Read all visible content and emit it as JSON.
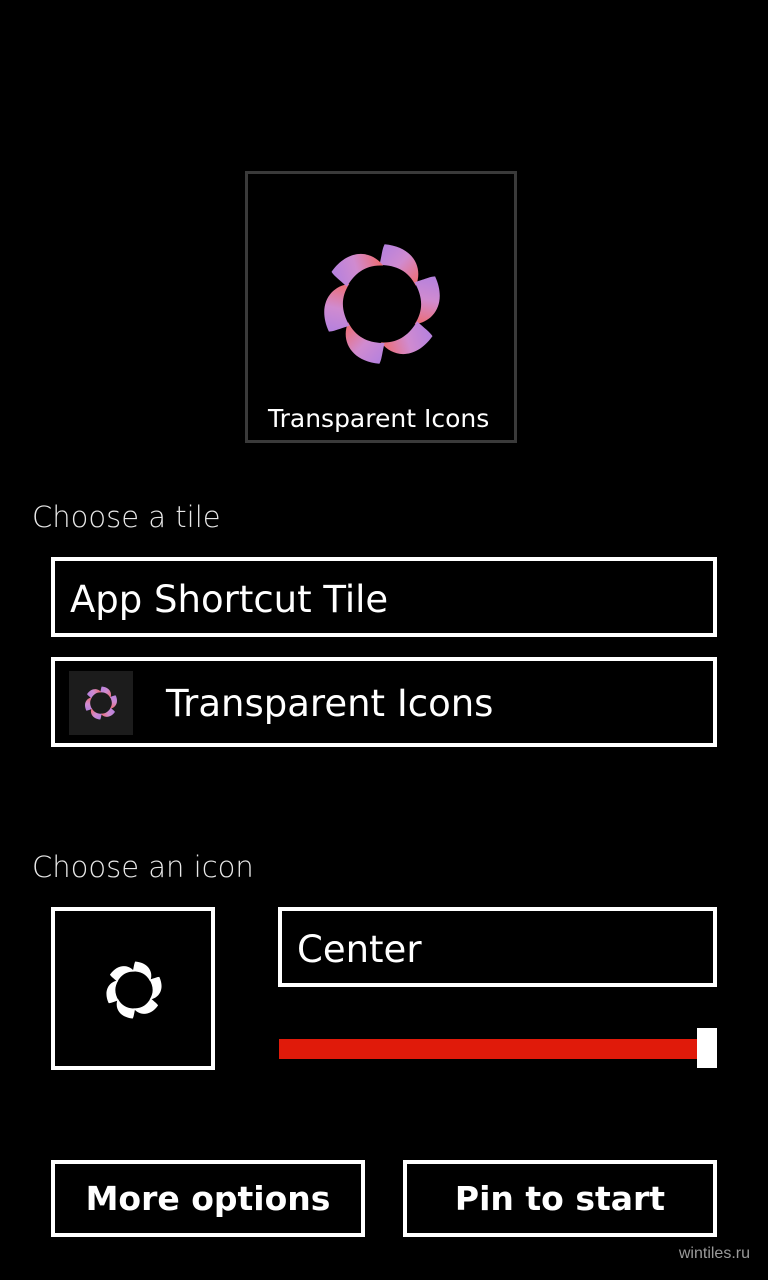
{
  "preview": {
    "title": "Transparent Icons",
    "logo_icon": "flower-swirl-icon"
  },
  "tile_section": {
    "label": "Choose a tile",
    "options": [
      {
        "label": "App Shortcut Tile"
      },
      {
        "label": "Transparent Icons",
        "icon": "flower-swirl-icon"
      }
    ]
  },
  "icon_section": {
    "label": "Choose an icon",
    "selected_icon": "flower-swirl-icon",
    "alignment": "Center",
    "size_slider_level": 1.0
  },
  "buttons": {
    "more_options": "More options",
    "pin_to_start": "Pin to start"
  },
  "watermark": "wintiles.ru",
  "colors": {
    "background": "#000000",
    "accent": "#e01a0a",
    "border": "#ffffff",
    "preview_border": "#3a3a3a"
  }
}
